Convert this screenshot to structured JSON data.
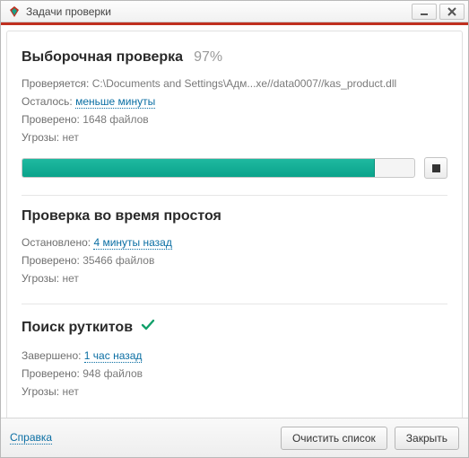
{
  "window": {
    "title": "Задачи проверки"
  },
  "scan1": {
    "title": "Выборочная проверка",
    "percent": "97%",
    "scanning_label": "Проверяется:",
    "scanning_value": "C:\\Documents and Settings\\Адм...xe//data0007//kas_product.dll",
    "remaining_label": "Осталось:",
    "remaining_value": "меньше минуты",
    "checked_label": "Проверено:",
    "checked_value": "1648 файлов",
    "threats_label": "Угрозы:",
    "threats_value": "нет"
  },
  "scan2": {
    "title": "Проверка во время простоя",
    "stopped_label": "Остановлено:",
    "stopped_value": "4 минуты назад",
    "checked_label": "Проверено:",
    "checked_value": "35466 файлов",
    "threats_label": "Угрозы:",
    "threats_value": "нет"
  },
  "scan3": {
    "title": "Поиск руткитов",
    "finished_label": "Завершено:",
    "finished_value": "1 час назад",
    "checked_label": "Проверено:",
    "checked_value": "948 файлов",
    "threats_label": "Угрозы:",
    "threats_value": "нет"
  },
  "footer": {
    "help": "Справка",
    "clear": "Очистить список",
    "close": "Закрыть"
  }
}
